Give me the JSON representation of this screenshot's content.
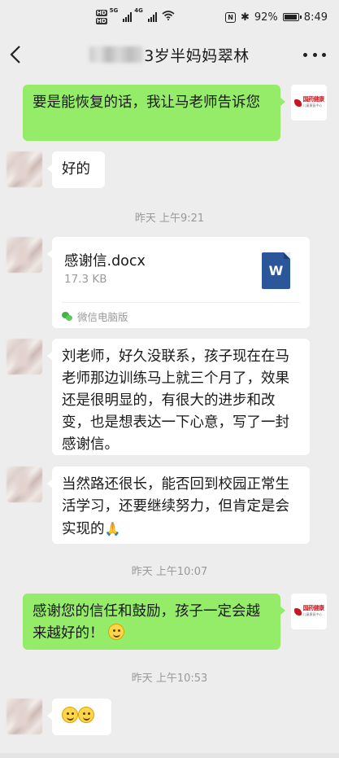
{
  "status_bar": {
    "hd_top": "HD",
    "hd_bottom": "HD",
    "network_1": "5G",
    "network_2": "4G",
    "nfc": "N",
    "bluetooth": "✱",
    "battery_percent": "92%",
    "battery_level": 0.92,
    "time": "8:49"
  },
  "header": {
    "back_icon": "chevron-left-icon",
    "title": "3岁半妈妈翠林",
    "more_icon": "more-dots-icon"
  },
  "colors": {
    "background": "#ededed",
    "incoming_bubble": "#ffffff",
    "outgoing_bubble": "#95ec69",
    "timestamp": "#999999",
    "word_blue": "#2b579a"
  },
  "messages": [
    {
      "side": "out",
      "text": "要是能恢复的话，我让马老师告诉您"
    },
    {
      "side": "in",
      "text": "好的"
    },
    {
      "type": "time",
      "text": "昨天 上午9:21"
    },
    {
      "side": "in",
      "type": "file",
      "file_name": "感谢信.docx",
      "file_size": "17.3 KB",
      "file_icon": "word-doc-icon",
      "source": "微信电脑版",
      "source_icon": "wechat-icon"
    },
    {
      "side": "in",
      "text": "刘老师，好久没联系，孩子现在在马老师那边训练马上就三个月了，效果还是很明显的，有很大的进步和改变，也是想表达一下心意，写了一封感谢信。"
    },
    {
      "side": "in",
      "text": "当然路还很长，能否回到校园正常生活学习，还要继续努力，但肯定是会实现的",
      "emoji": "praying-hands-icon"
    },
    {
      "type": "time",
      "text": "昨天 上午10:07"
    },
    {
      "side": "out",
      "text": "感谢您的信任和鼓励，孩子一定会越来越好的！",
      "emoji": "smile-emoji-icon"
    },
    {
      "type": "time",
      "text": "昨天 上午10:53"
    },
    {
      "side": "in",
      "emoji": "smile-emoji-icon",
      "emoji_count": 2
    }
  ],
  "agency_logo": {
    "name": "国药健康",
    "sub": "儿童康复中心"
  }
}
